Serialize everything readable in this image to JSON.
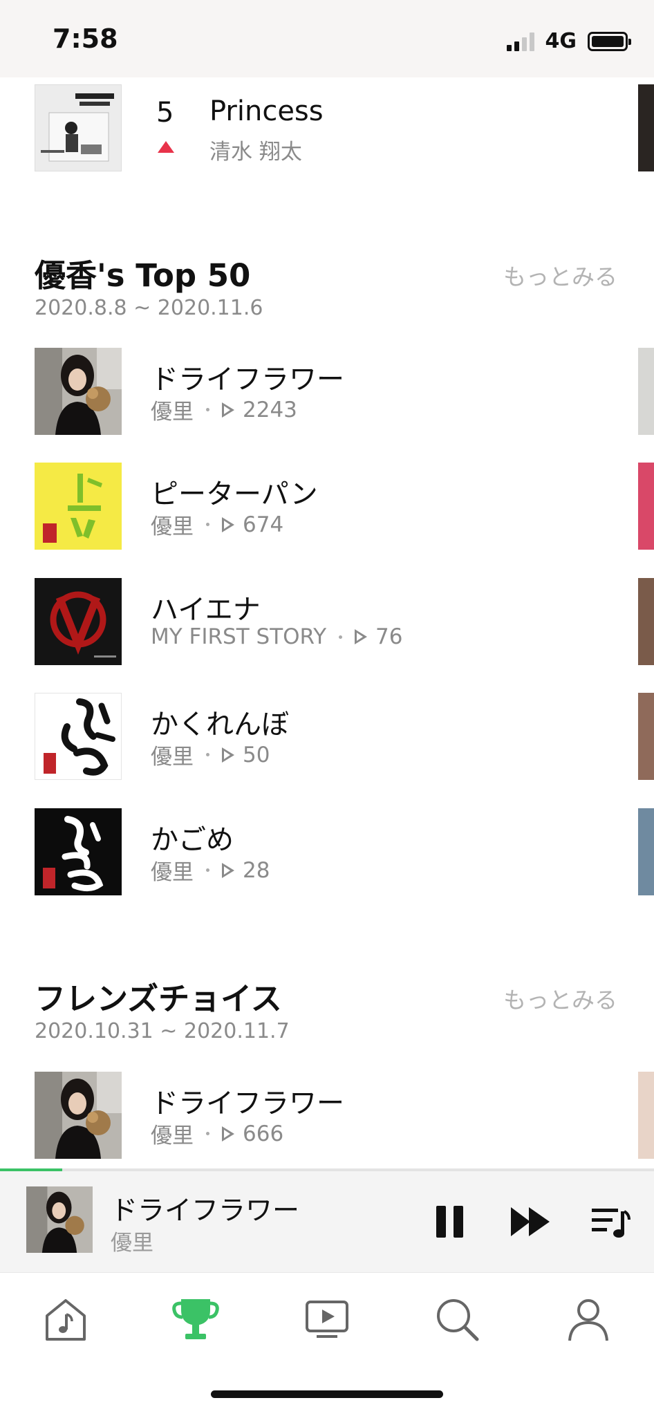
{
  "status_bar": {
    "time": "7:58",
    "network": "4G"
  },
  "top_item": {
    "rank": "5",
    "title": "Princess",
    "artist": "清水 翔太",
    "trend": "up"
  },
  "sections": [
    {
      "title": "優香's Top 50",
      "date_range": "2020.8.8 ~ 2020.11.6",
      "more_label": "もっとみる",
      "items": [
        {
          "title": "ドライフラワー",
          "artist": "優里",
          "plays": "2243"
        },
        {
          "title": "ピーターパン",
          "artist": "優里",
          "plays": "674"
        },
        {
          "title": "ハイエナ",
          "artist": "MY FIRST STORY",
          "plays": "76"
        },
        {
          "title": "かくれんぼ",
          "artist": "優里",
          "plays": "50"
        },
        {
          "title": "かごめ",
          "artist": "優里",
          "plays": "28"
        }
      ]
    },
    {
      "title": "フレンズチョイス",
      "date_range": "2020.10.31 ~ 2020.11.7",
      "more_label": "もっとみる",
      "items": [
        {
          "title": "ドライフラワー",
          "artist": "優里",
          "plays": "666"
        }
      ]
    }
  ],
  "now_playing": {
    "title": "ドライフラワー",
    "artist": "優里",
    "progress": 0.095
  },
  "tabs": [
    "home-icon",
    "trophy-icon",
    "video-icon",
    "search-icon",
    "profile-icon"
  ],
  "colors": {
    "accent": "#3bc266",
    "trend_up": "#e8334a",
    "muted_text": "#8a8a8a"
  }
}
